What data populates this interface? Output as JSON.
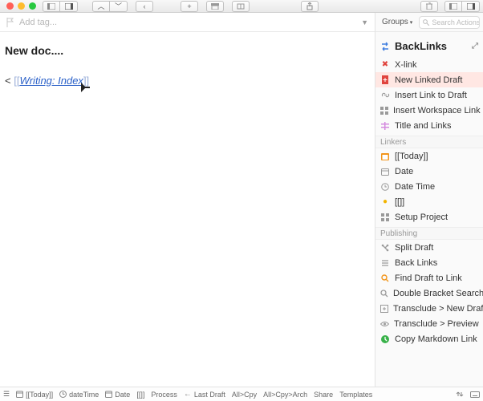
{
  "toolbar": {
    "groups_label": "Groups",
    "search_placeholder": "Search Actions"
  },
  "tagbar": {
    "placeholder": "Add tag..."
  },
  "doc": {
    "title": "New doc....",
    "line_prefix": "< ",
    "link_open": "[[",
    "link_text": "Writing: Index",
    "link_close": "]]"
  },
  "panel": {
    "title": "BackLinks",
    "sections": {
      "linkers": "Linkers",
      "publishing": "Publishing"
    },
    "items": {
      "xlink": "X-link",
      "new_linked": "New Linked Draft",
      "insert_link": "Insert Link to Draft",
      "insert_ws": "Insert Workspace Link",
      "title_links": "Title and Links",
      "today": "[[Today]]",
      "date": "Date",
      "datetime": "Date Time",
      "brackets": "[[]]",
      "setup": "Setup Project",
      "split": "Split Draft",
      "backlinks": "Back Links",
      "find_link": "Find Draft to Link",
      "dbs": "Double Bracket Search",
      "trans_new": "Transclude > New Draft",
      "trans_prev": "Transclude > Preview",
      "copy_md": "Copy Markdown Link"
    }
  },
  "bottombar": {
    "today": "[[Today]]",
    "datetime": "dateTime",
    "date": "Date",
    "brackets": "[[]]",
    "process": "Process",
    "lastdraft": "Last Draft",
    "allcpy": "All>Cpy",
    "allcpyarch": "All>Cpy>Arch",
    "share": "Share",
    "templates": "Templates"
  }
}
